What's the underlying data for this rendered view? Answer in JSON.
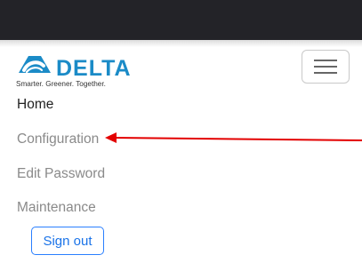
{
  "brand": {
    "name": "DELTA",
    "tagline": "Smarter. Greener. Together.",
    "logo_color": "#1b8bc7"
  },
  "nav": {
    "items": [
      {
        "label": "Home"
      },
      {
        "label": "Configuration"
      },
      {
        "label": "Edit Password"
      },
      {
        "label": "Maintenance"
      }
    ],
    "signout_label": "Sign out"
  },
  "menu_toggle_icon": "hamburger-icon",
  "annotation": {
    "arrow_color": "#e30000"
  }
}
